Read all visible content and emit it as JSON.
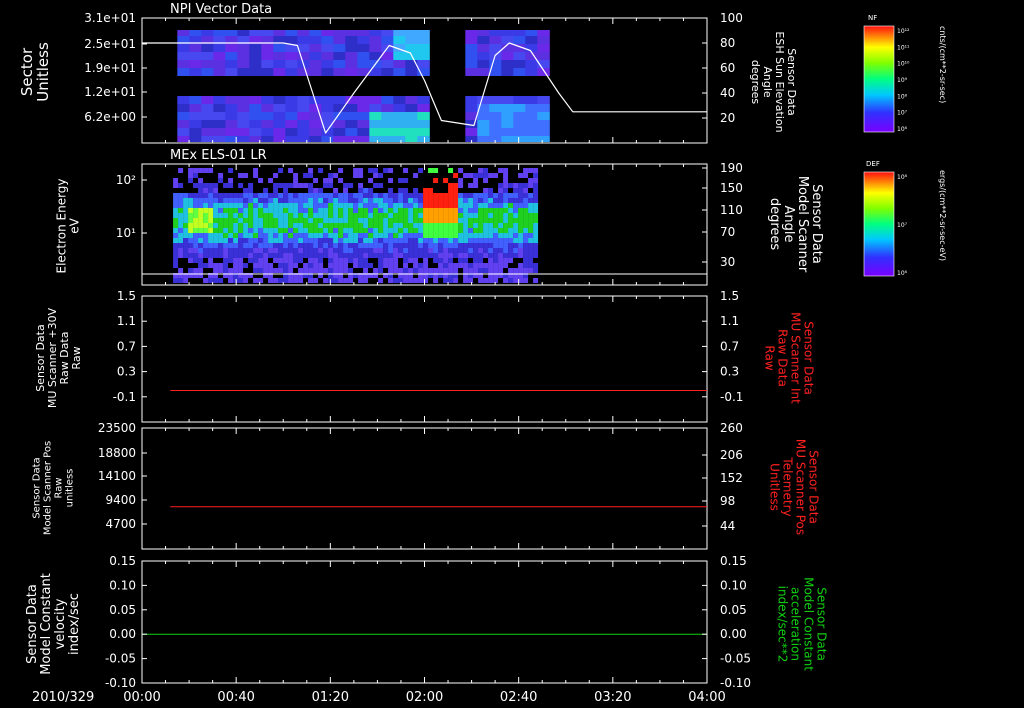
{
  "figure": {
    "date_label": "2010/329",
    "x_ticks": [
      "00:00",
      "00:40",
      "01:20",
      "02:00",
      "02:40",
      "03:20",
      "04:00"
    ],
    "x_range_hours": [
      0,
      4
    ]
  },
  "colors": {
    "axis": "#ffffff",
    "red_trace": "#ff2020",
    "green_trace": "#10d010",
    "sun_line": "#ffffff"
  },
  "colorbars": [
    {
      "label": "NF",
      "tick_labels": [
        "10¹²",
        "10¹¹",
        "10¹⁰",
        "10⁹",
        "10⁸",
        "10⁷",
        "10⁶"
      ],
      "units": "cnts/(cm**2-sr-sec)"
    },
    {
      "label": "DEF",
      "tick_labels": [
        "10⁸",
        "10⁷",
        "10⁶"
      ],
      "units": "ergs/(cm**2-sr-sec-eV)"
    }
  ],
  "chart_data": [
    {
      "type": "heatmap",
      "title": "NPI Vector Data",
      "ylabel": [
        "Sector",
        "Unitless"
      ],
      "y_ticks": [
        "3.1e+01",
        "2.5e+01",
        "1.9e+01",
        "1.2e+01",
        "6.2e+00"
      ],
      "y2label": [
        "Sensor Data",
        "ESH Sun Elevation",
        "Angle",
        "degrees"
      ],
      "y2_ticks": [
        "100",
        "80",
        "60",
        "40",
        "20"
      ],
      "y2lim": [
        0,
        100
      ],
      "overlay_series": {
        "name": "ESH Sun Elevation Angle",
        "x_hours": [
          0.0,
          1.0,
          1.1,
          1.3,
          1.5,
          1.75,
          1.9,
          2.0,
          2.12,
          2.35,
          2.5,
          2.6,
          2.75,
          2.95,
          3.05,
          3.2,
          4.0
        ],
        "y": [
          80,
          80,
          78,
          8,
          40,
          78,
          72,
          50,
          18,
          14,
          70,
          80,
          74,
          40,
          25,
          25,
          25
        ]
      }
    },
    {
      "type": "heatmap",
      "title": "MEx ELS-01 LR",
      "ylabel": [
        "Electron Energy",
        "eV"
      ],
      "y_ticks": [
        "10²",
        "10¹"
      ],
      "y2label": [
        "Sensor Data",
        "Model Scanner",
        "Angle",
        "degrees"
      ],
      "y2_ticks": [
        "190",
        "150",
        "110",
        "70",
        "30"
      ],
      "y2lim": [
        0,
        190
      ],
      "overlay_series": {
        "name": "Model Scanner Angle",
        "x_hours": [
          0,
          4
        ],
        "y": [
          10,
          10
        ]
      }
    },
    {
      "type": "line",
      "ylabel": [
        "Sensor Data",
        "MU Scanner +30V",
        "Raw Data",
        "Raw"
      ],
      "y_ticks": [
        "1.5",
        "1.1",
        "0.7",
        "0.3",
        "-0.1"
      ],
      "ylim": [
        -0.5,
        1.5
      ],
      "y2label": [
        "Sensor Data",
        "MU Scanner Int",
        "Raw Data",
        "Raw"
      ],
      "y2_ticks": [
        "1.5",
        "1.1",
        "0.7",
        "0.3",
        "-0.1"
      ],
      "series": [
        {
          "x_hours": [
            0.2,
            4.0
          ],
          "y": [
            0.0,
            0.0
          ]
        }
      ]
    },
    {
      "type": "line",
      "ylabel": [
        "Sensor Data",
        "Model Scanner Pos",
        "Raw",
        "unitless"
      ],
      "y_ticks": [
        "23500",
        "18800",
        "14100",
        "9400",
        "4700"
      ],
      "ylim": [
        0,
        23500
      ],
      "y2label": [
        "Sensor Data",
        "MU Scanner Pos",
        "Telemetry",
        "Unitless"
      ],
      "y2_ticks": [
        "260",
        "206",
        "152",
        "98",
        "44"
      ],
      "series": [
        {
          "x_hours": [
            0.2,
            4.0
          ],
          "y": [
            8200,
            8200
          ]
        }
      ]
    },
    {
      "type": "line",
      "ylabel": [
        "Sensor Data",
        "Model Constant",
        "velocity",
        "index/sec"
      ],
      "y_ticks": [
        "0.15",
        "0.10",
        "0.05",
        "0.00",
        "-0.05",
        "-0.10"
      ],
      "ylim": [
        -0.1,
        0.15
      ],
      "y2label": [
        "Sensor Data",
        "Model Constant",
        "acceleration",
        "index/sec**2"
      ],
      "y2_ticks": [
        "0.15",
        "0.10",
        "0.05",
        "0.00",
        "-0.05",
        "-0.10"
      ],
      "series": [
        {
          "x_hours": [
            0.0,
            4.0
          ],
          "y": [
            0.0,
            0.0
          ]
        }
      ]
    }
  ]
}
